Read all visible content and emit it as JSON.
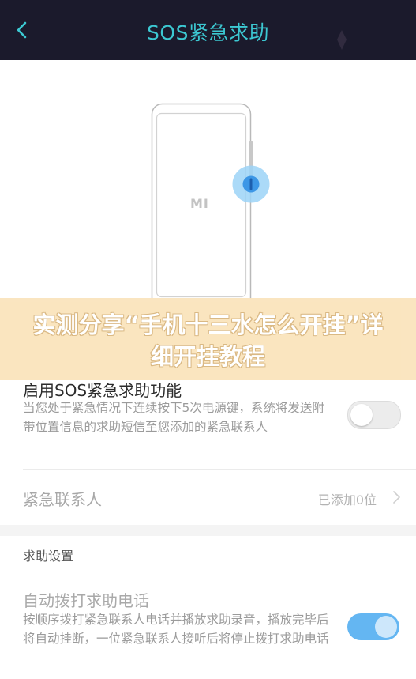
{
  "header": {
    "title": "SOS紧急求助",
    "back_icon": "chevron-left-icon",
    "background": "#1b1a2c",
    "title_color": "#3cc8d2"
  },
  "illustration": {
    "brand_mark": "MI"
  },
  "banner": {
    "text": "实测分享“手机十三水怎么开挂”详细开挂教程"
  },
  "sos_setting": {
    "title": "启用SOS紧急求助功能",
    "description": "当您处于紧急情况下连续按下5次电源键，系统将发送附带位置信息的求助短信至您添加的紧急联系人",
    "enabled": false
  },
  "contacts": {
    "label": "紧急联系人",
    "value": "已添加0位"
  },
  "help_settings": {
    "section_title": "求助设置",
    "auto_call": {
      "title": "自动拨打求助电话",
      "description": "按顺序拨打紧急联系人电话并播放求助录音，播放完毕后将自动挂断，一位紧急联系人接听后将停止拨打求助电话",
      "enabled": true
    }
  },
  "colors": {
    "accent": "#64b6f2",
    "banner": "#fae4bd"
  }
}
